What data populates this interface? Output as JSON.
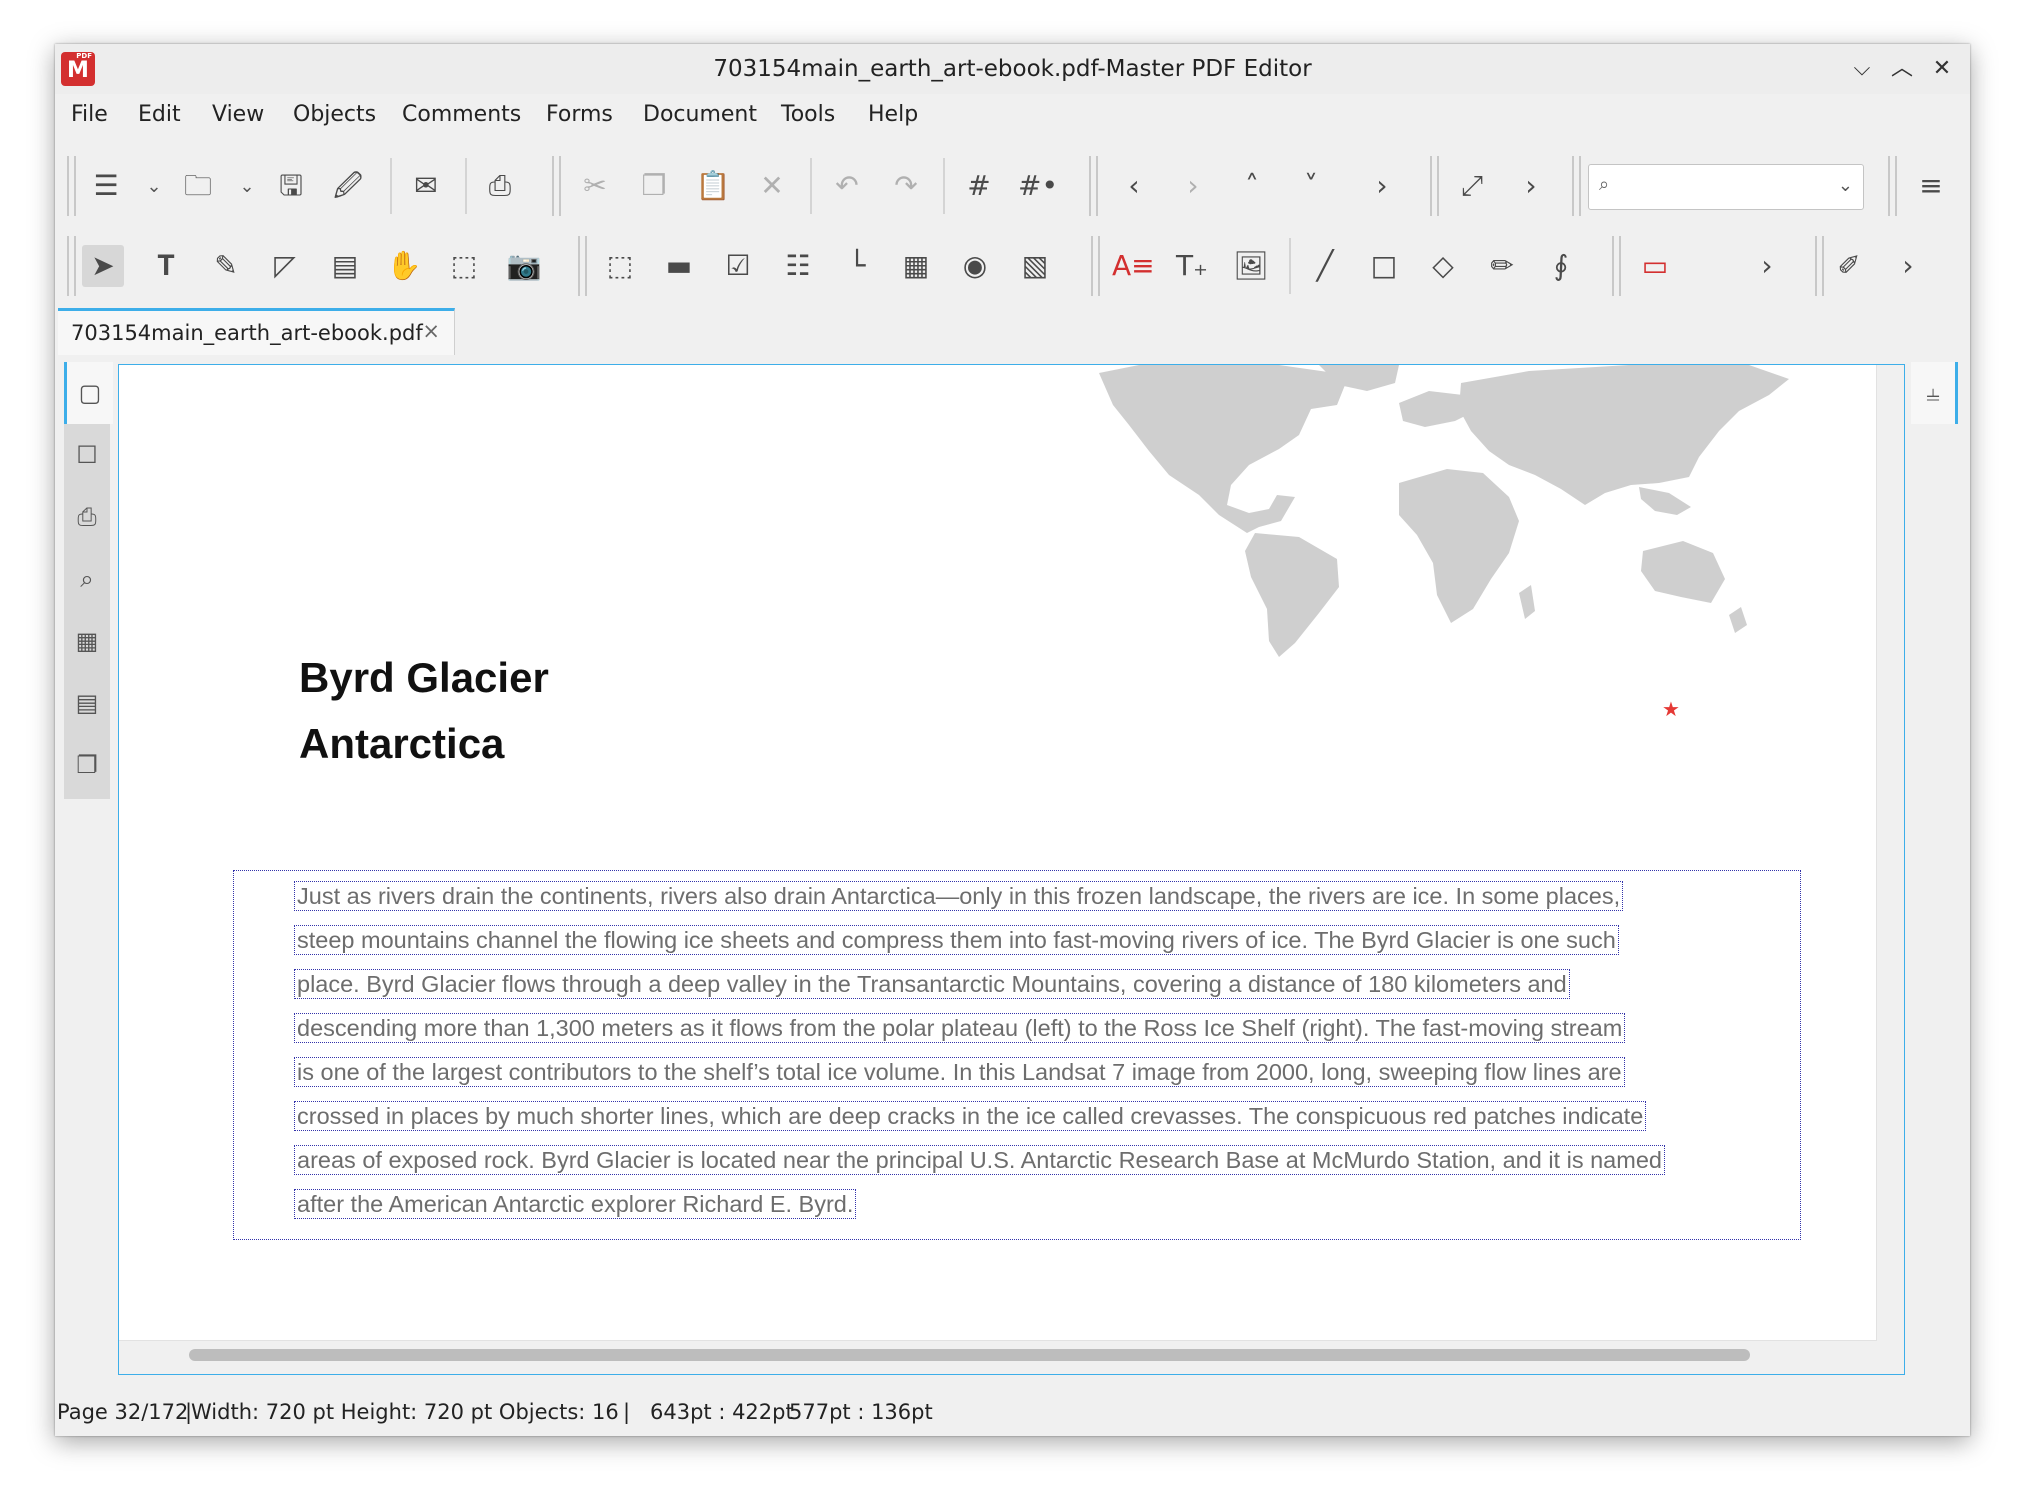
{
  "window": {
    "title": "703154main_earth_art-ebook.pdf-Master PDF Editor",
    "logo_text": "M",
    "logo_badge": "PDF",
    "controls": {
      "minimize": "⌵",
      "maximize": "︿",
      "close": "✕"
    }
  },
  "menu": [
    "File",
    "Edit",
    "View",
    "Objects",
    "Comments",
    "Forms",
    "Document",
    "Tools",
    "Help"
  ],
  "toolbar1": {
    "icons": [
      "new-document-icon",
      "open-folder-icon",
      "save-icon",
      "save-as-icon",
      "email-icon",
      "print-icon",
      "cut-icon",
      "copy-icon",
      "paste-icon",
      "delete-icon",
      "undo-icon",
      "redo-icon",
      "grid-icon",
      "snap-grid-icon",
      "previous-page-icon",
      "next-page-icon",
      "first-page-icon",
      "last-page-icon",
      "more-chevron-icon",
      "fit-page-icon",
      "more-chevron-icon",
      "hamburger-menu-icon"
    ],
    "search": {
      "value": "",
      "placeholder": ""
    }
  },
  "toolbar2": {
    "icons": [
      "select-arrow-icon",
      "edit-text-icon",
      "edit-object-icon",
      "add-link-icon",
      "form-edit-icon",
      "hand-pan-icon",
      "marquee-select-icon",
      "snapshot-camera-icon",
      "text-field-icon",
      "button-field-icon",
      "checkbox-field-icon",
      "listbox-field-icon",
      "combobox-field-icon",
      "list-field-icon",
      "radio-button-icon",
      "signature-field-icon",
      "text-highlight-icon",
      "add-text-icon",
      "add-image-icon",
      "line-icon",
      "rectangle-icon",
      "polygon-icon",
      "pencil-icon",
      "signature-icon",
      "red-comment-icon",
      "more-chevron-icon",
      "eraser-icon",
      "more-chevron-icon"
    ]
  },
  "tab": {
    "label": "703154main_earth_art-ebook.pdf",
    "close": "×"
  },
  "sidebar": [
    "page-thumbnails-icon",
    "bookmarks-icon",
    "attachments-icon",
    "search-icon",
    "layers-icon",
    "signatures-icon",
    "pages-copy-icon"
  ],
  "document": {
    "title_line1": "Byrd Glacier",
    "title_line2": "Antarctica",
    "star": "★",
    "lines": [
      "Just as rivers drain the continents, rivers also drain Antarctica—only in this frozen landscape, the rivers are ice. In some places,",
      "steep mountains channel the flowing ice sheets and compress them into fast-moving rivers of ice. The Byrd Glacier is one such",
      "place. Byrd Glacier flows through a deep valley in the Transantarctic Mountains, covering a distance of 180 kilometers and",
      "descending more than 1,300 meters as it flows from the polar plateau (left) to the Ross Ice Shelf (right). The fast-moving stream",
      "is one of the largest contributors to the shelf’s total ice volume. In this Landsat 7 image from 2000, long, sweeping flow lines are",
      "crossed in places by much shorter lines, which are deep cracks in the ice called crevasses. The conspicuous red patches indicate",
      "areas of exposed rock. Byrd Glacier is located near the principal U.S. Antarctic Research Base at McMurdo Station, and it is named",
      "after the American Antarctic explorer Richard E. Byrd."
    ]
  },
  "status": {
    "page": "Page 32/172",
    "dims": "Width: 720 pt Height: 720 pt Objects: 16",
    "divider": "|",
    "pos1": "643pt : 422pt",
    "pos2": "577pt : 136pt"
  },
  "colors": {
    "accent": "#3daee9",
    "logo": "#d32f2f",
    "star": "#e53935",
    "selection": "#3333aa"
  }
}
